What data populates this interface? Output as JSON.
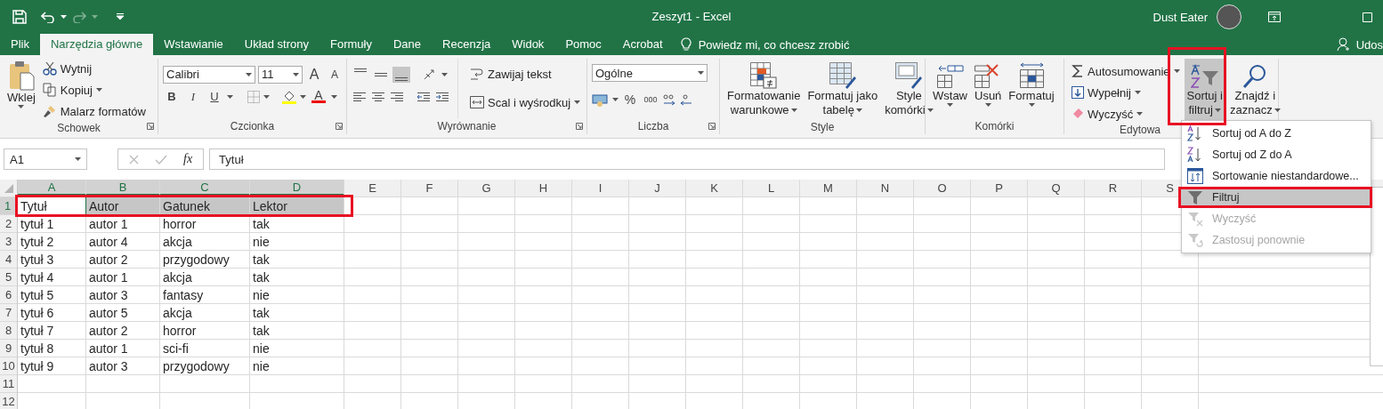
{
  "title_bar": {
    "title": "Zeszyt1  -  Excel",
    "user": "Dust Eater"
  },
  "tabs": [
    {
      "label": "Plik",
      "selected": false
    },
    {
      "label": "Narzędzia główne",
      "selected": true
    },
    {
      "label": "Wstawianie",
      "selected": false
    },
    {
      "label": "Układ strony",
      "selected": false
    },
    {
      "label": "Formuły",
      "selected": false
    },
    {
      "label": "Dane",
      "selected": false
    },
    {
      "label": "Recenzja",
      "selected": false
    },
    {
      "label": "Widok",
      "selected": false
    },
    {
      "label": "Pomoc",
      "selected": false
    },
    {
      "label": "Acrobat",
      "selected": false
    }
  ],
  "tell_me": {
    "placeholder": "Powiedz mi, co chcesz zrobić"
  },
  "share": "Udos",
  "ribbon": {
    "clipboard": {
      "label": "Schowek",
      "paste": "Wklej",
      "cut": "Wytnij",
      "copy": "Kopiuj",
      "painter": "Malarz formatów"
    },
    "font": {
      "label": "Czcionka",
      "font_name": "Calibri",
      "font_size": "11",
      "grow": "A",
      "shrink": "A",
      "bold": "B",
      "italic": "I",
      "underline": "U",
      "font_color": "A"
    },
    "alignment": {
      "label": "Wyrównanie",
      "wrap": "Zawijaj tekst",
      "merge": "Scal i wyśrodkuj"
    },
    "number": {
      "label": "Liczba",
      "format": "Ogólne",
      "percent": "%",
      "thousands": "000"
    },
    "styles": {
      "label": "Style",
      "items": [
        {
          "kind": "conditional",
          "lines": [
            "Formatowanie",
            "warunkowe"
          ]
        },
        {
          "kind": "table",
          "lines": [
            "Formatuj jako",
            "tabelę"
          ]
        },
        {
          "kind": "cell",
          "lines": [
            "Style",
            "komórki"
          ]
        }
      ]
    },
    "cells": {
      "label": "Komórki",
      "items": [
        {
          "kind": "insert",
          "label": "Wstaw"
        },
        {
          "kind": "delete",
          "label": "Usuń"
        },
        {
          "kind": "format",
          "label": "Formatuj"
        }
      ]
    },
    "editing": {
      "label": "Edytowa",
      "autosum": "Autosumowanie",
      "fill": "Wypełnij",
      "clear": "Wyczyść",
      "sort": {
        "lines": [
          "Sortuj i",
          "filtruj"
        ],
        "selected": true
      },
      "find": {
        "lines": [
          "Znajdź i",
          "zaznacz"
        ]
      }
    }
  },
  "formula_bar": {
    "name_box": "A1",
    "fx": "fx",
    "value": "Tytuł"
  },
  "sheet": {
    "columns": [
      {
        "letter": "A",
        "selected": true
      },
      {
        "letter": "B",
        "selected": true
      },
      {
        "letter": "C",
        "selected": true
      },
      {
        "letter": "D",
        "selected": true
      },
      {
        "letter": "E",
        "selected": false
      },
      {
        "letter": "F",
        "selected": false
      },
      {
        "letter": "G",
        "selected": false
      },
      {
        "letter": "H",
        "selected": false
      },
      {
        "letter": "I",
        "selected": false
      },
      {
        "letter": "J",
        "selected": false
      },
      {
        "letter": "K",
        "selected": false
      },
      {
        "letter": "L",
        "selected": false
      },
      {
        "letter": "M",
        "selected": false
      },
      {
        "letter": "N",
        "selected": false
      },
      {
        "letter": "O",
        "selected": false
      },
      {
        "letter": "P",
        "selected": false
      },
      {
        "letter": "Q",
        "selected": false
      },
      {
        "letter": "R",
        "selected": false
      },
      {
        "letter": "S",
        "selected": false
      }
    ],
    "rows": [
      {
        "number": "1",
        "selected": true,
        "cells": [
          "Tytuł",
          "Autor",
          "Gatunek",
          "Lektor"
        ]
      },
      {
        "number": "2",
        "selected": false,
        "cells": [
          "tytuł 1",
          "autor 1",
          "horror",
          "tak"
        ]
      },
      {
        "number": "3",
        "selected": false,
        "cells": [
          "tytuł 2",
          "autor 4",
          "akcja",
          "nie"
        ]
      },
      {
        "number": "4",
        "selected": false,
        "cells": [
          "tytuł 3",
          "autor 2",
          "przygodowy",
          "tak"
        ]
      },
      {
        "number": "5",
        "selected": false,
        "cells": [
          "tytuł 4",
          "autor 1",
          "akcja",
          "tak"
        ]
      },
      {
        "number": "6",
        "selected": false,
        "cells": [
          "tytuł 5",
          "autor 3",
          "fantasy",
          "nie"
        ]
      },
      {
        "number": "7",
        "selected": false,
        "cells": [
          "tytuł 6",
          "autor 5",
          "akcja",
          "tak"
        ]
      },
      {
        "number": "8",
        "selected": false,
        "cells": [
          "tytuł 7",
          "autor 2",
          "horror",
          "tak"
        ]
      },
      {
        "number": "9",
        "selected": false,
        "cells": [
          "tytuł 8",
          "autor 1",
          "sci-fi",
          "nie"
        ]
      },
      {
        "number": "10",
        "selected": false,
        "cells": [
          "tytuł 9",
          "autor 3",
          "przygodowy",
          "nie"
        ]
      },
      {
        "number": "11",
        "selected": false,
        "cells": []
      },
      {
        "number": "12",
        "selected": false,
        "cells": []
      }
    ]
  },
  "sort_menu": {
    "items": [
      {
        "kind": "sort-az",
        "label": "Sortuj od A do Z",
        "selected": false,
        "disabled": false
      },
      {
        "kind": "sort-za",
        "label": "Sortuj od Z do A",
        "selected": false,
        "disabled": false
      },
      {
        "kind": "custom",
        "label": "Sortowanie niestandardowe...",
        "selected": false,
        "disabled": false
      },
      {
        "kind": "filter",
        "label": "Filtruj",
        "selected": true,
        "disabled": false
      },
      {
        "kind": "clear",
        "label": "Wyczyść",
        "selected": false,
        "disabled": true
      },
      {
        "kind": "reapply",
        "label": "Zastosuj ponownie",
        "selected": false,
        "disabled": true
      }
    ]
  },
  "highlight_frames": [
    {
      "kind": "header-cells"
    },
    {
      "kind": "sort-button"
    },
    {
      "kind": "filter-item"
    }
  ]
}
